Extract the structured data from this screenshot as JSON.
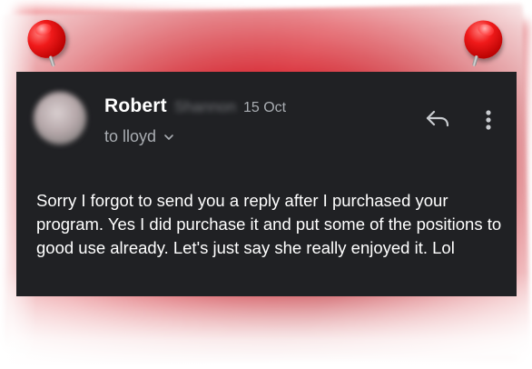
{
  "email": {
    "sender_first_name": "Robert",
    "sender_surname_blurred": "Shannon",
    "date": "15 Oct",
    "recipient_label": "to lloyd",
    "message_body": "Sorry I forgot to send you a reply after I purchased your program. Yes I did purchase it and put some of the positions to good use already. Let's just say she really enjoyed it. Lol"
  },
  "icons": {
    "reply": "reply-icon",
    "more": "more-vertical-icon",
    "expand": "chevron-down-icon",
    "pin": "push-pin-icon"
  },
  "colors": {
    "card_background": "#202124",
    "paper_red": "#c4101a",
    "pin_red": "#f01a1a",
    "secondary_text": "#a9adb2"
  }
}
